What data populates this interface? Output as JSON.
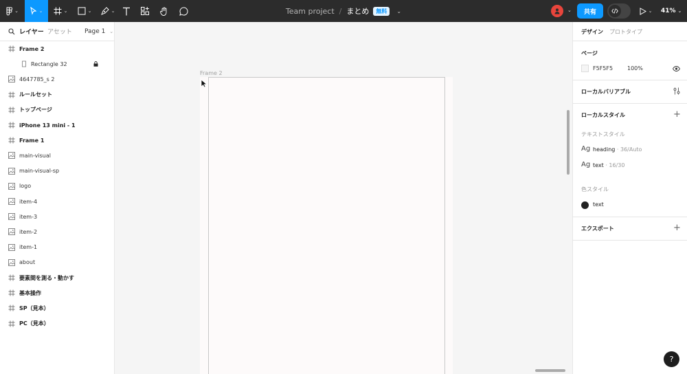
{
  "toolbar": {
    "project": "Team project",
    "separator": "/",
    "file_name": "まとめ",
    "plan_badge": "無料",
    "share_label": "共有",
    "zoom": "41%"
  },
  "left_panel": {
    "tab_layers": "レイヤー",
    "tab_assets": "アセット",
    "page_selector": "Page 1",
    "layers": [
      {
        "label": "Frame 2",
        "type": "frame",
        "bold": true
      },
      {
        "label": "Rectangle 32",
        "type": "rect",
        "bold": false,
        "child": true,
        "locked": true
      },
      {
        "label": "4647785_s 2",
        "type": "image",
        "bold": false
      },
      {
        "label": "ルールセット",
        "type": "frame",
        "bold": true
      },
      {
        "label": "トップページ",
        "type": "frame",
        "bold": true
      },
      {
        "label": "iPhone 13 mini - 1",
        "type": "frame",
        "bold": true
      },
      {
        "label": "Frame 1",
        "type": "frame",
        "bold": true
      },
      {
        "label": "main-visual",
        "type": "image",
        "bold": false
      },
      {
        "label": "main-visual-sp",
        "type": "image",
        "bold": false
      },
      {
        "label": "logo",
        "type": "image",
        "bold": false
      },
      {
        "label": "item-4",
        "type": "image",
        "bold": false
      },
      {
        "label": "item-3",
        "type": "image",
        "bold": false
      },
      {
        "label": "item-2",
        "type": "image",
        "bold": false
      },
      {
        "label": "item-1",
        "type": "image",
        "bold": false
      },
      {
        "label": "about",
        "type": "image",
        "bold": false
      },
      {
        "label": "要素間を測る・動かす",
        "type": "frame",
        "bold": true
      },
      {
        "label": "基本操作",
        "type": "frame",
        "bold": true
      },
      {
        "label": "SP（見本）",
        "type": "frame",
        "bold": true
      },
      {
        "label": "PC（見本）",
        "type": "frame",
        "bold": true
      }
    ]
  },
  "canvas": {
    "frame_label": "Frame 2"
  },
  "right_panel": {
    "tab_design": "デザイン",
    "tab_prototype": "プロトタイプ",
    "page_section": "ページ",
    "page_color": "F5F5F5",
    "page_opacity": "100%",
    "local_variables": "ローカルバリアブル",
    "local_styles": "ローカルスタイル",
    "text_styles_title": "テキストスタイル",
    "text_styles": [
      {
        "glyph": "Ag",
        "name": "heading",
        "meta": " · 36/Auto"
      },
      {
        "glyph": "Ag",
        "name": "text",
        "meta": " · 16/30"
      }
    ],
    "color_styles_title": "色スタイル",
    "color_style_name": "text",
    "export": "エクスポート"
  },
  "help_label": "?",
  "colors": {
    "toolbar_bg": "#2c2c2c",
    "accent": "#0d99ff",
    "avatar": "#e8453c",
    "page_bg": "#F5F5F5"
  }
}
